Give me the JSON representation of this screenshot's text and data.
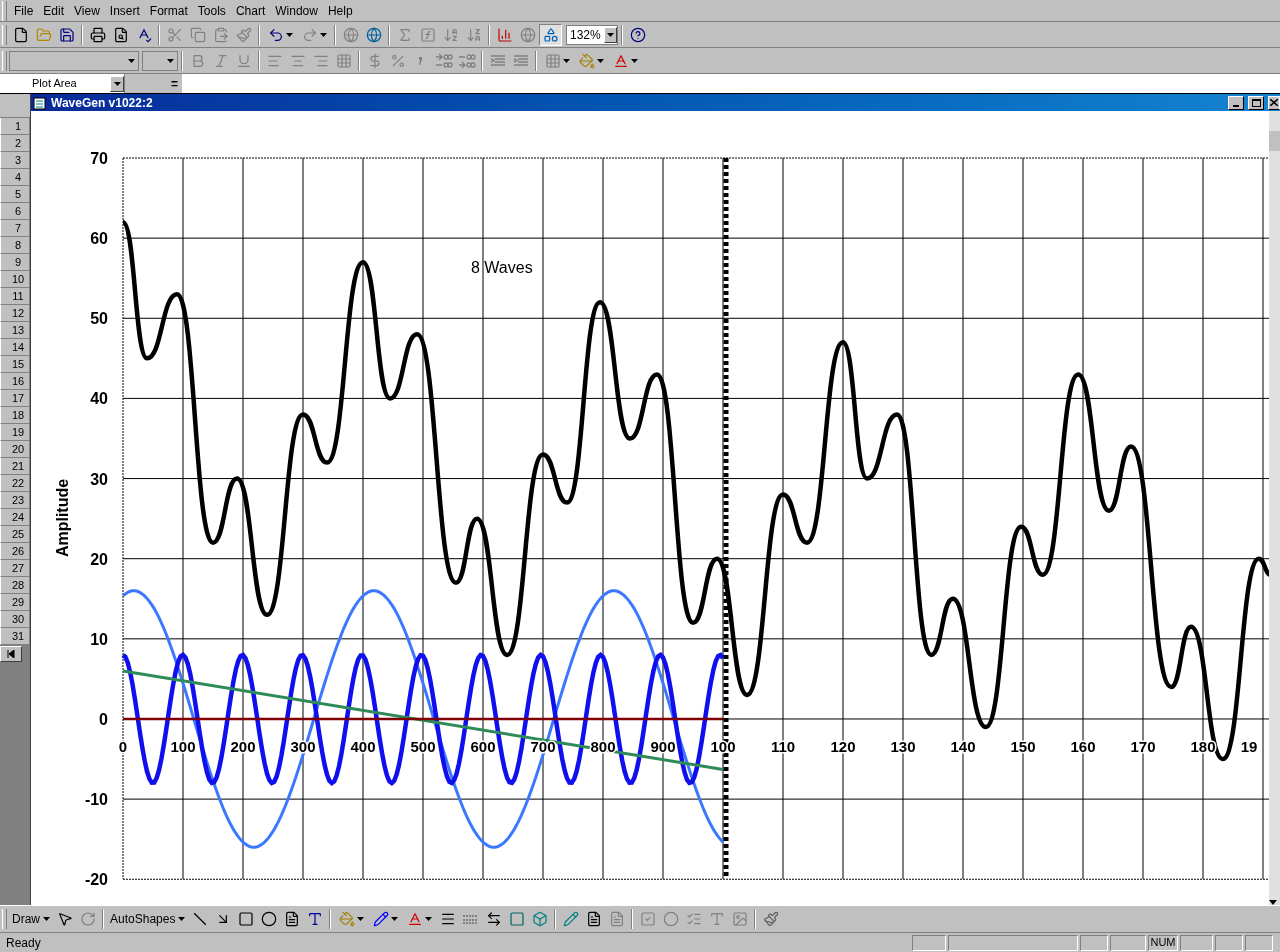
{
  "menu_bar": [
    {
      "label": "File"
    },
    {
      "label": "Edit"
    },
    {
      "label": "View"
    },
    {
      "label": "Insert"
    },
    {
      "label": "Format"
    },
    {
      "label": "Tools"
    },
    {
      "label": "Chart"
    },
    {
      "label": "Window"
    },
    {
      "label": "Help"
    }
  ],
  "standard_toolbar": {
    "zoom": "132%",
    "drawing_toggle_on": true
  },
  "name_box": {
    "value": "Plot Area"
  },
  "formula_bar": {
    "equals": "="
  },
  "row_headers": [
    "1",
    "2",
    "3",
    "4",
    "5",
    "6",
    "7",
    "8",
    "9",
    "10",
    "11",
    "12",
    "13",
    "14",
    "15",
    "16",
    "17",
    "18",
    "19",
    "20",
    "21",
    "22",
    "23",
    "24",
    "25",
    "26",
    "27",
    "28",
    "29",
    "30",
    "31"
  ],
  "chart_window": {
    "title": "WaveGen v1022:2"
  },
  "chart": {
    "y_axis_title": "Amplitude",
    "annotation": "8 Waves",
    "yticks": [
      "70",
      "60",
      "50",
      "40",
      "30",
      "20",
      "10",
      "0",
      "-10",
      "-20"
    ],
    "xticks": [
      "0",
      "100",
      "200",
      "300",
      "400",
      "500",
      "600",
      "700",
      "800",
      "900",
      "100",
      "110",
      "120",
      "130",
      "140",
      "150",
      "160",
      "170",
      "180",
      "19"
    ]
  },
  "drawing_toolbar": {
    "draw": "Draw",
    "autoshapes": "AutoShapes"
  },
  "status_bar": {
    "text": "Ready",
    "indicators": [
      "NUM"
    ]
  }
}
